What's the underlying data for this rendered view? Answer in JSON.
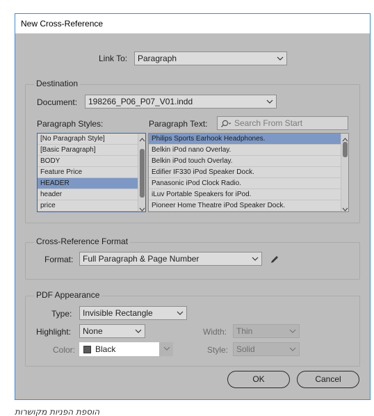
{
  "window": {
    "title": "New Cross-Reference"
  },
  "link_to": {
    "label": "Link To:",
    "value": "Paragraph"
  },
  "destination": {
    "section_title": "Destination",
    "document_label": "Document:",
    "document_value": "198266_P06_P07_V01.indd",
    "styles_label": "Paragraph Styles:",
    "text_label": "Paragraph Text:",
    "search_placeholder": "Search From Start",
    "styles": [
      "[No Paragraph Style]",
      "[Basic Paragraph]",
      "BODY",
      "Feature Price",
      "HEADER",
      "header",
      "price"
    ],
    "styles_selected_index": 4,
    "texts": [
      "Philips Sports Earhook Headphones.",
      "Belkin iPod nano Overlay.",
      "Belkin iPod touch Overlay.",
      "Edifier IF330 iPod Speaker Dock.",
      "Panasonic iPod Clock Radio.",
      "iLuv Portable Speakers for iPod.",
      "Pioneer Home Theatre iPod Speaker Dock."
    ],
    "texts_selected_index": 0
  },
  "format": {
    "section_title": "Cross-Reference Format",
    "label": "Format:",
    "value": "Full Paragraph & Page Number"
  },
  "pdf": {
    "section_title": "PDF Appearance",
    "type_label": "Type:",
    "type_value": "Invisible Rectangle",
    "highlight_label": "Highlight:",
    "highlight_value": "None",
    "width_label": "Width:",
    "width_value": "Thin",
    "color_label": "Color:",
    "color_value": "Black",
    "style_label": "Style:",
    "style_value": "Solid"
  },
  "buttons": {
    "ok": "OK",
    "cancel": "Cancel"
  },
  "caption": "הוספת הפניות מקושרות",
  "colors": {
    "accent": "#3a8bd8",
    "selection": "#7d98c4",
    "dialog_bg": "#bdbdbd"
  }
}
